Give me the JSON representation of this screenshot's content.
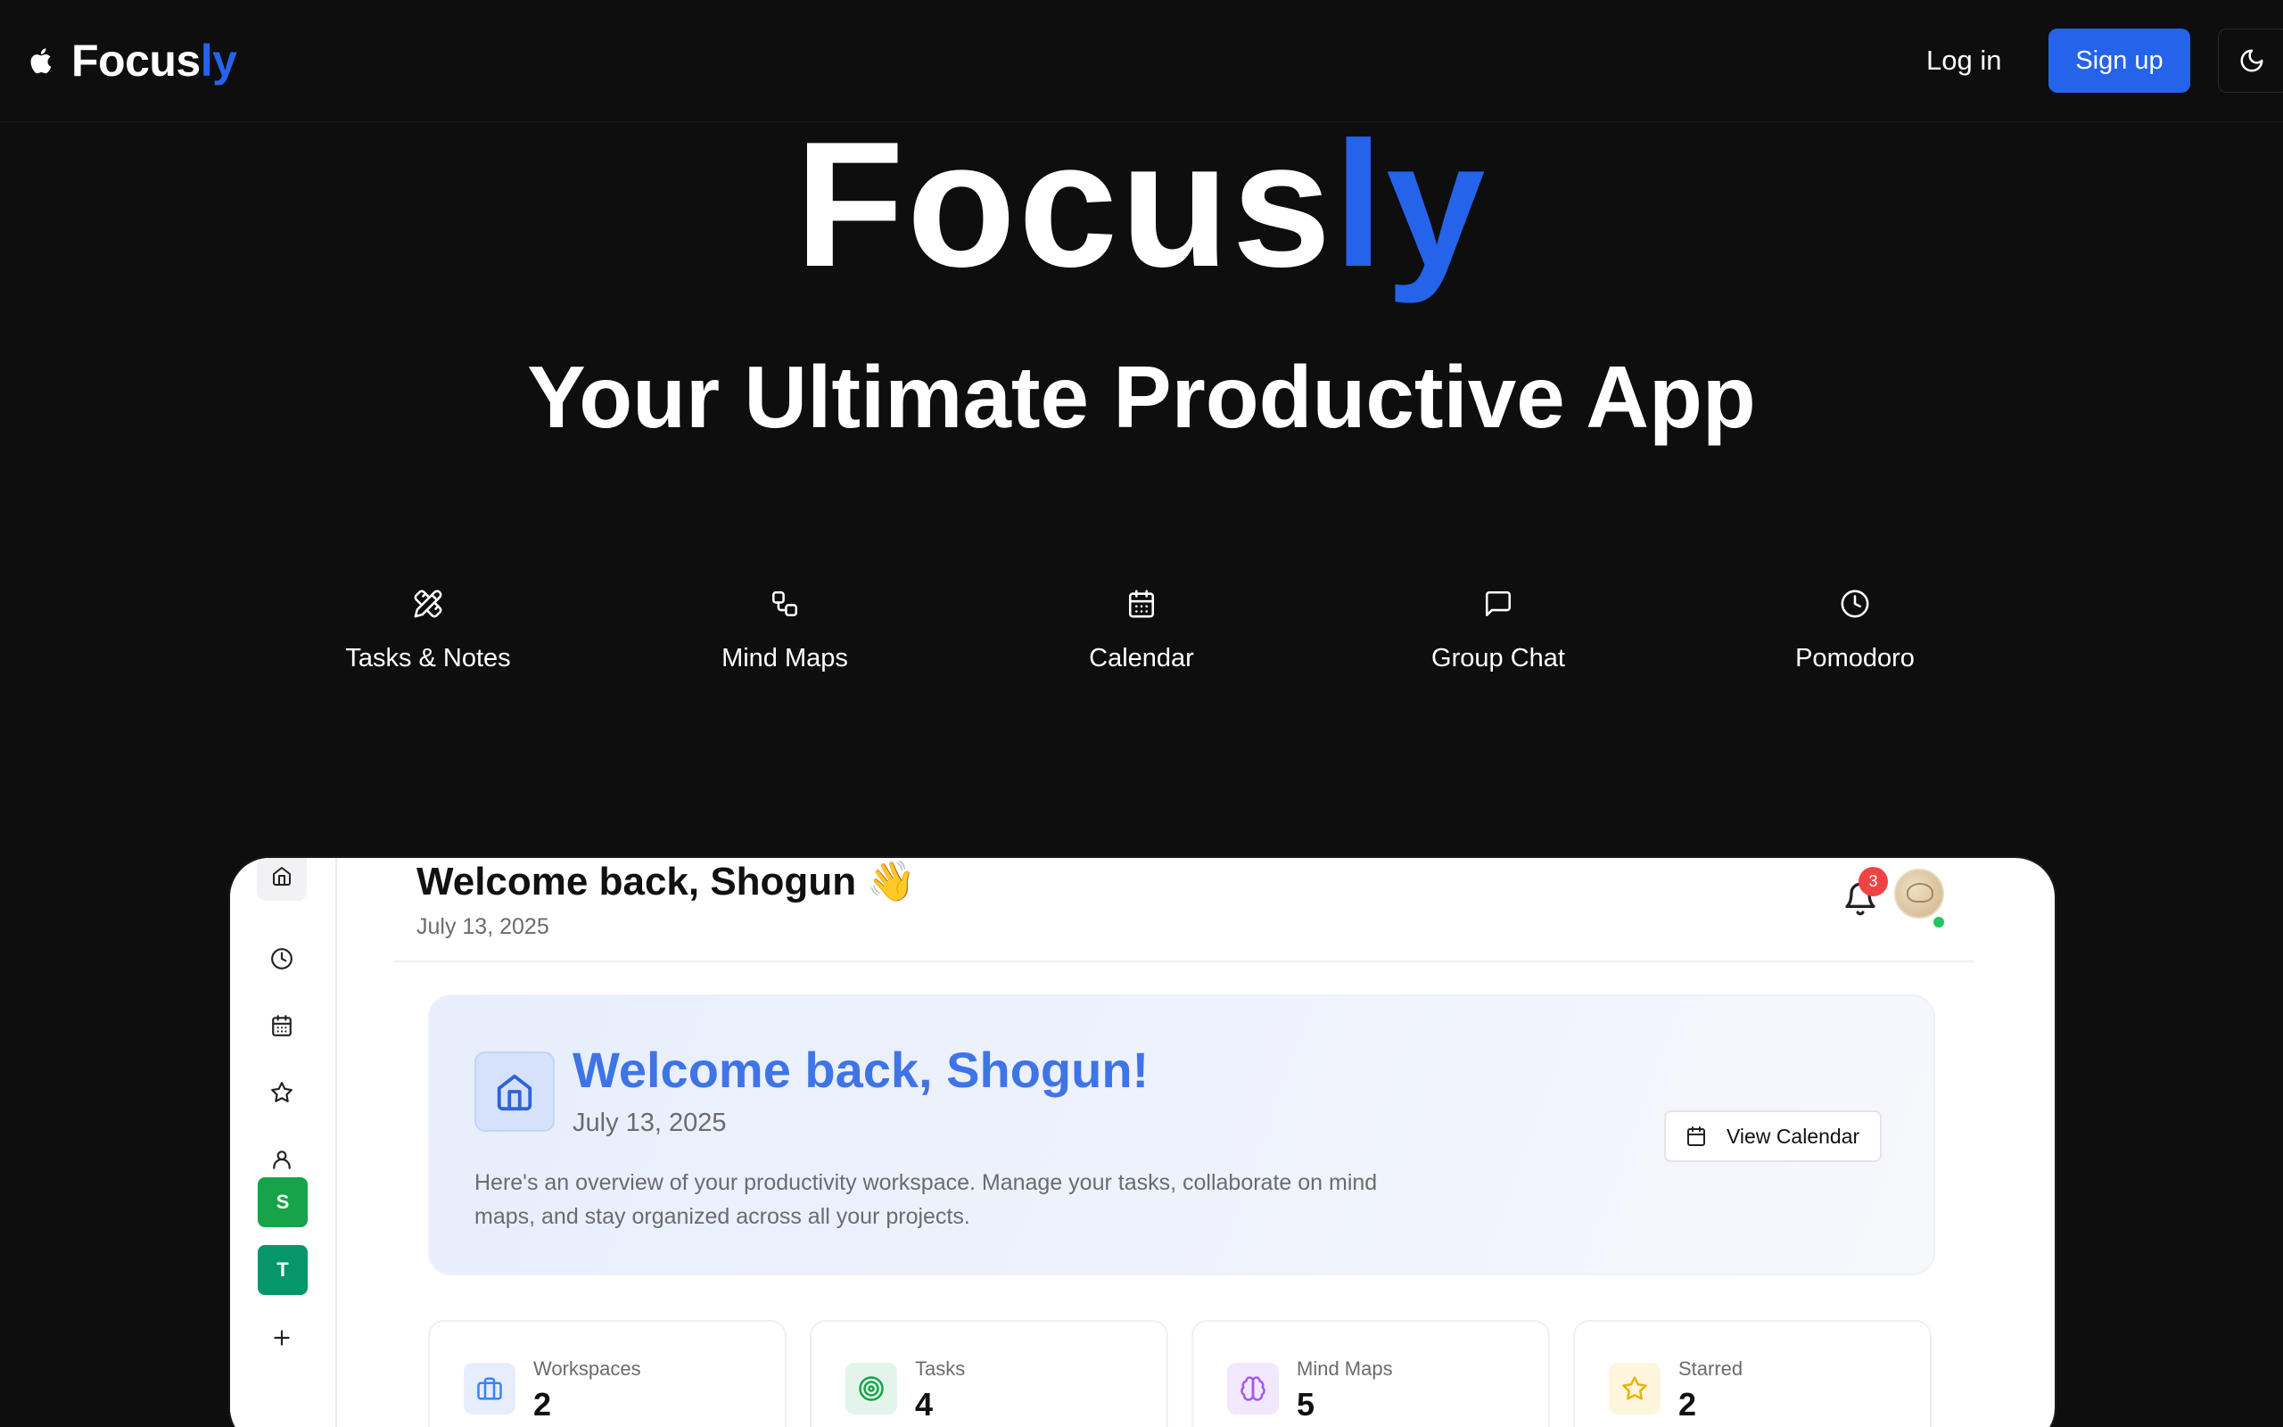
{
  "nav": {
    "brand_main": "Focus",
    "brand_accent": "ly",
    "login_label": "Log in",
    "signup_label": "Sign up",
    "theme_icon": "moon-icon"
  },
  "hero": {
    "title_main": "Focus",
    "title_accent": "ly",
    "subtitle": "Your Ultimate Productive App"
  },
  "features": [
    {
      "label": "Tasks & Notes",
      "icon": "pencil-ruler-icon"
    },
    {
      "label": "Mind Maps",
      "icon": "workflow-icon"
    },
    {
      "label": "Calendar",
      "icon": "calendar-icon"
    },
    {
      "label": "Group Chat",
      "icon": "message-square-icon"
    },
    {
      "label": "Pomodoro",
      "icon": "clock-icon"
    }
  ],
  "preview": {
    "header_title": "Welcome back, Shogun 👋",
    "header_date": "July 13, 2025",
    "notification_count": "3",
    "sidebar": {
      "icons": [
        "home-icon",
        "clock-icon",
        "calendar-icon",
        "star-icon",
        "user-icon",
        "plus-icon"
      ],
      "workspaces": [
        {
          "letter": "S",
          "color": "#16a34a"
        },
        {
          "letter": "T",
          "color": "#059669"
        }
      ]
    },
    "welcome_card": {
      "title": "Welcome back, Shogun!",
      "date": "July 13, 2025",
      "description": "Here's an overview of your productivity workspace. Manage your tasks, collaborate on mind maps, and stay organized across all your projects.",
      "button_label": "View Calendar"
    },
    "stats": [
      {
        "label": "Workspaces",
        "value": "2",
        "icon": "briefcase-icon",
        "color": "#3b82f6"
      },
      {
        "label": "Tasks",
        "value": "4",
        "icon": "target-icon",
        "color": "#16a34a"
      },
      {
        "label": "Mind Maps",
        "value": "5",
        "icon": "brain-icon",
        "color": "#a855f7"
      },
      {
        "label": "Starred",
        "value": "2",
        "icon": "star-icon",
        "color": "#eab308"
      }
    ]
  },
  "colors": {
    "accent": "#2563eb",
    "background": "#0e0e0f"
  }
}
